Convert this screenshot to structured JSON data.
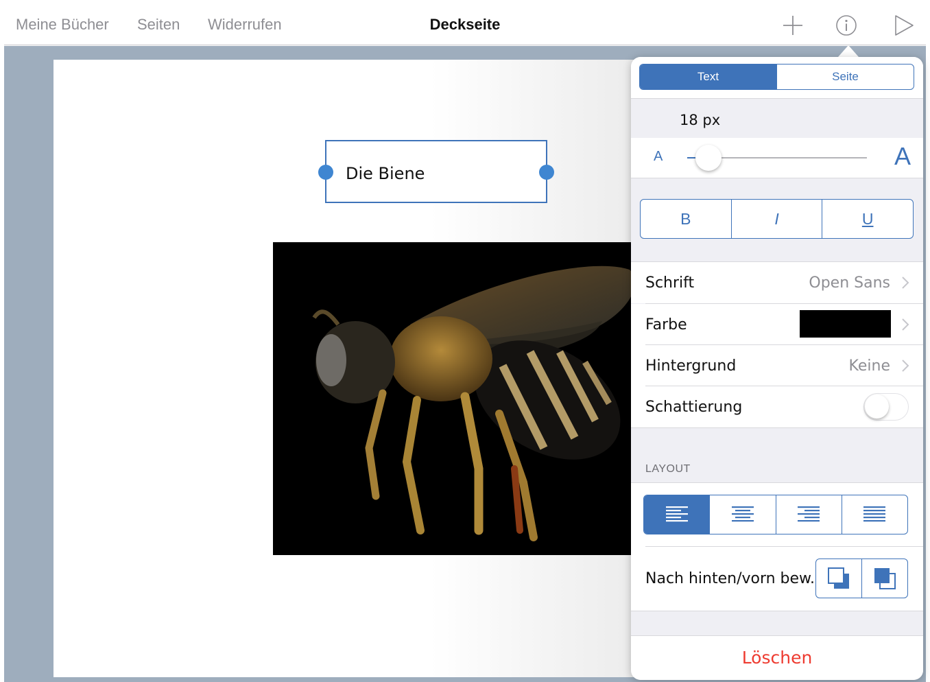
{
  "topbar": {
    "my_books": "Meine Bücher",
    "pages": "Seiten",
    "undo": "Widerrufen",
    "title": "Deckseite"
  },
  "canvas": {
    "textbox_text": "Die Biene",
    "image_subject": "bee-photo"
  },
  "inspector": {
    "tabs": [
      {
        "label": "Text",
        "active": true
      },
      {
        "label": "Seite",
        "active": false
      }
    ],
    "font_size": "18 px",
    "font_size_value_fraction": 0.12,
    "slider_small_label": "A",
    "slider_large_label": "A",
    "style_buttons": {
      "bold": "B",
      "italic": "I",
      "underline": "U"
    },
    "font_row": {
      "label": "Schrift",
      "value": "Open Sans"
    },
    "color_row": {
      "label": "Farbe",
      "swatch": "#000000"
    },
    "background_row": {
      "label": "Hintergrund",
      "value": "Keine"
    },
    "shadow_row": {
      "label": "Schattierung",
      "enabled": false
    },
    "layout_header": "LAYOUT",
    "alignment": {
      "selected": "left",
      "options": [
        "left",
        "center",
        "right",
        "justify"
      ]
    },
    "arrange_row": {
      "label": "Nach hinten/vorn bew..."
    },
    "delete_label": "Löschen"
  },
  "colors": {
    "accent": "#3E73B9",
    "handle": "#3F86D1",
    "delete": "#EE3B30",
    "workspace": "#9EADBD"
  }
}
